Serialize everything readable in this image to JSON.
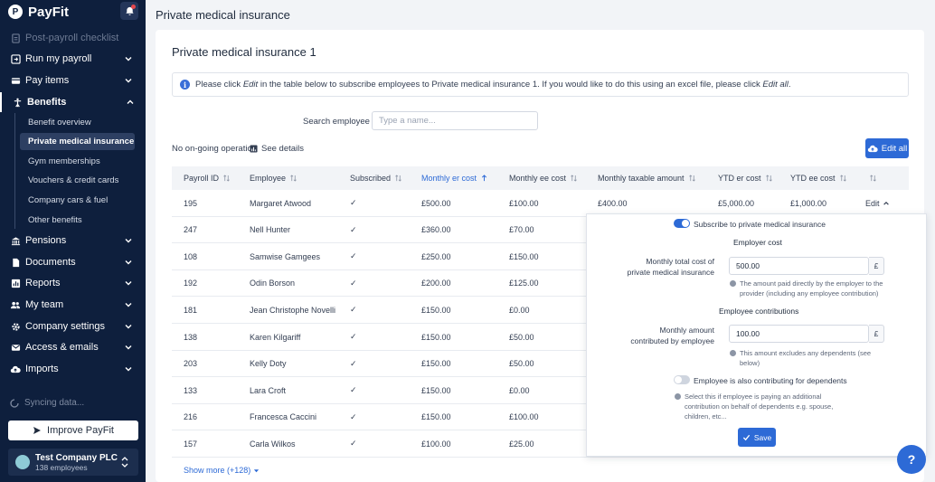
{
  "app": {
    "name": "PayFit",
    "logo_letter": "P"
  },
  "sidebar": {
    "items": [
      {
        "label": "Post-payroll checklist",
        "icon": "checklist-icon"
      },
      {
        "label": "Run my payroll",
        "icon": "payroll-icon"
      },
      {
        "label": "Pay items",
        "icon": "pay-items-icon"
      },
      {
        "label": "Benefits",
        "icon": "benefits-icon"
      },
      {
        "label": "Pensions",
        "icon": "pensions-icon"
      },
      {
        "label": "Documents",
        "icon": "documents-icon"
      },
      {
        "label": "Reports",
        "icon": "reports-icon"
      },
      {
        "label": "My team",
        "icon": "team-icon"
      },
      {
        "label": "Company settings",
        "icon": "settings-icon"
      },
      {
        "label": "Access & emails",
        "icon": "mail-icon"
      },
      {
        "label": "Imports",
        "icon": "imports-icon"
      }
    ],
    "benefits_sub": [
      "Benefit overview",
      "Private medical insurance",
      "Gym memberships",
      "Vouchers & credit cards",
      "Company cars & fuel",
      "Other benefits"
    ],
    "syncing": "Syncing data...",
    "improve": "Improve PayFit",
    "company": {
      "name": "Test Company PLC",
      "employees": "138 employees"
    }
  },
  "page": {
    "title": "Private medical insurance",
    "card_title": "Private medical insurance 1",
    "info": {
      "p1": "Please click ",
      "edit": "Edit",
      "p2": " in the table below to subscribe employees to Private medical insurance 1. If you would like to do this using an excel file, please click ",
      "editall": "Edit all",
      "p3": "."
    },
    "search": {
      "label": "Search employee",
      "placeholder": "Type a name..."
    },
    "ongoing": "No on-going operation",
    "see_details": "See details",
    "edit_all": "Edit all",
    "show_more": "Show more (+128)"
  },
  "table": {
    "headers": [
      "Payroll ID",
      "Employee",
      "Subscribed",
      "Monthly er cost",
      "Monthly ee cost",
      "Monthly taxable amount",
      "YTD er cost",
      "YTD ee cost"
    ],
    "sorted_column": "Monthly er cost",
    "edit_label": "Edit",
    "rows": [
      {
        "id": "195",
        "name": "Margaret Atwood",
        "sub": "✓",
        "er": "£500.00",
        "ee": "£100.00",
        "tax": "£400.00",
        "ytd_er": "£5,000.00",
        "ytd_ee": "£1,000.00"
      },
      {
        "id": "247",
        "name": "Nell Hunter",
        "sub": "✓",
        "er": "£360.00",
        "ee": "£70.00"
      },
      {
        "id": "108",
        "name": "Samwise Gamgees",
        "sub": "✓",
        "er": "£250.00",
        "ee": "£150.00"
      },
      {
        "id": "192",
        "name": "Odin Borson",
        "sub": "✓",
        "er": "£200.00",
        "ee": "£125.00"
      },
      {
        "id": "181",
        "name": "Jean Christophe Novelli",
        "sub": "✓",
        "er": "£150.00",
        "ee": "£0.00"
      },
      {
        "id": "138",
        "name": "Karen Kilgariff",
        "sub": "✓",
        "er": "£150.00",
        "ee": "£50.00"
      },
      {
        "id": "203",
        "name": "Kelly Doty",
        "sub": "✓",
        "er": "£150.00",
        "ee": "£50.00"
      },
      {
        "id": "133",
        "name": "Lara Croft",
        "sub": "✓",
        "er": "£150.00",
        "ee": "£0.00"
      },
      {
        "id": "216",
        "name": "Francesca Caccini",
        "sub": "✓",
        "er": "£150.00",
        "ee": "£100.00"
      },
      {
        "id": "157",
        "name": "Carla Wilkos",
        "sub": "✓",
        "er": "£100.00",
        "ee": "£25.00"
      }
    ]
  },
  "popover": {
    "subscribe_label": "Subscribe to private medical insurance",
    "subscribe_on": true,
    "employer_heading": "Employer cost",
    "employer_label_1": "Monthly total cost of",
    "employer_label_2": "private medical insurance",
    "employer_value": "500.00",
    "currency": "£",
    "employer_hint_1": "The amount paid directly by the employer to the",
    "employer_hint_2": "provider (including any employee contribution)",
    "employee_heading": "Employee contributions",
    "employee_label_1": "Monthly amount",
    "employee_label_2": "contributed by employee",
    "employee_value": "100.00",
    "employee_hint_1": "This amount excludes any dependents (see",
    "employee_hint_2": "below)",
    "dependents_label": "Employee is also contributing for dependents",
    "dependents_on": false,
    "dependents_hint_1": "Select this if employee is paying an additional",
    "dependents_hint_2": "contribution on behalf of dependents e.g. spouse,",
    "dependents_hint_3": "children, etc...",
    "save": "Save"
  },
  "help": "?",
  "colors": {
    "sidebar": "#0e1f3d",
    "accent": "#2d6ad6",
    "background": "#f2f4f7"
  }
}
